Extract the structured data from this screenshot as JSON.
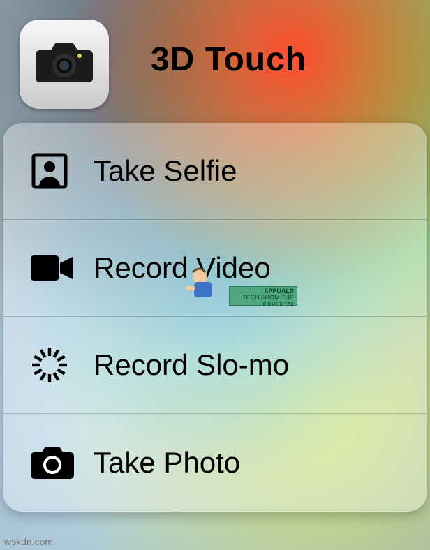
{
  "title": "3D Touch",
  "app_icon": {
    "name": "camera-app-icon"
  },
  "menu": {
    "items": [
      {
        "icon": "selfie-icon",
        "label": "Take Selfie"
      },
      {
        "icon": "video-icon",
        "label": "Record Video"
      },
      {
        "icon": "slomo-icon",
        "label": "Record Slo-mo"
      },
      {
        "icon": "camera-icon",
        "label": "Take Photo"
      }
    ]
  },
  "watermark": {
    "line1": "APPUALS",
    "line2": "TECH FROM THE EXPERTS!"
  },
  "attribution": "wsxdn.com"
}
